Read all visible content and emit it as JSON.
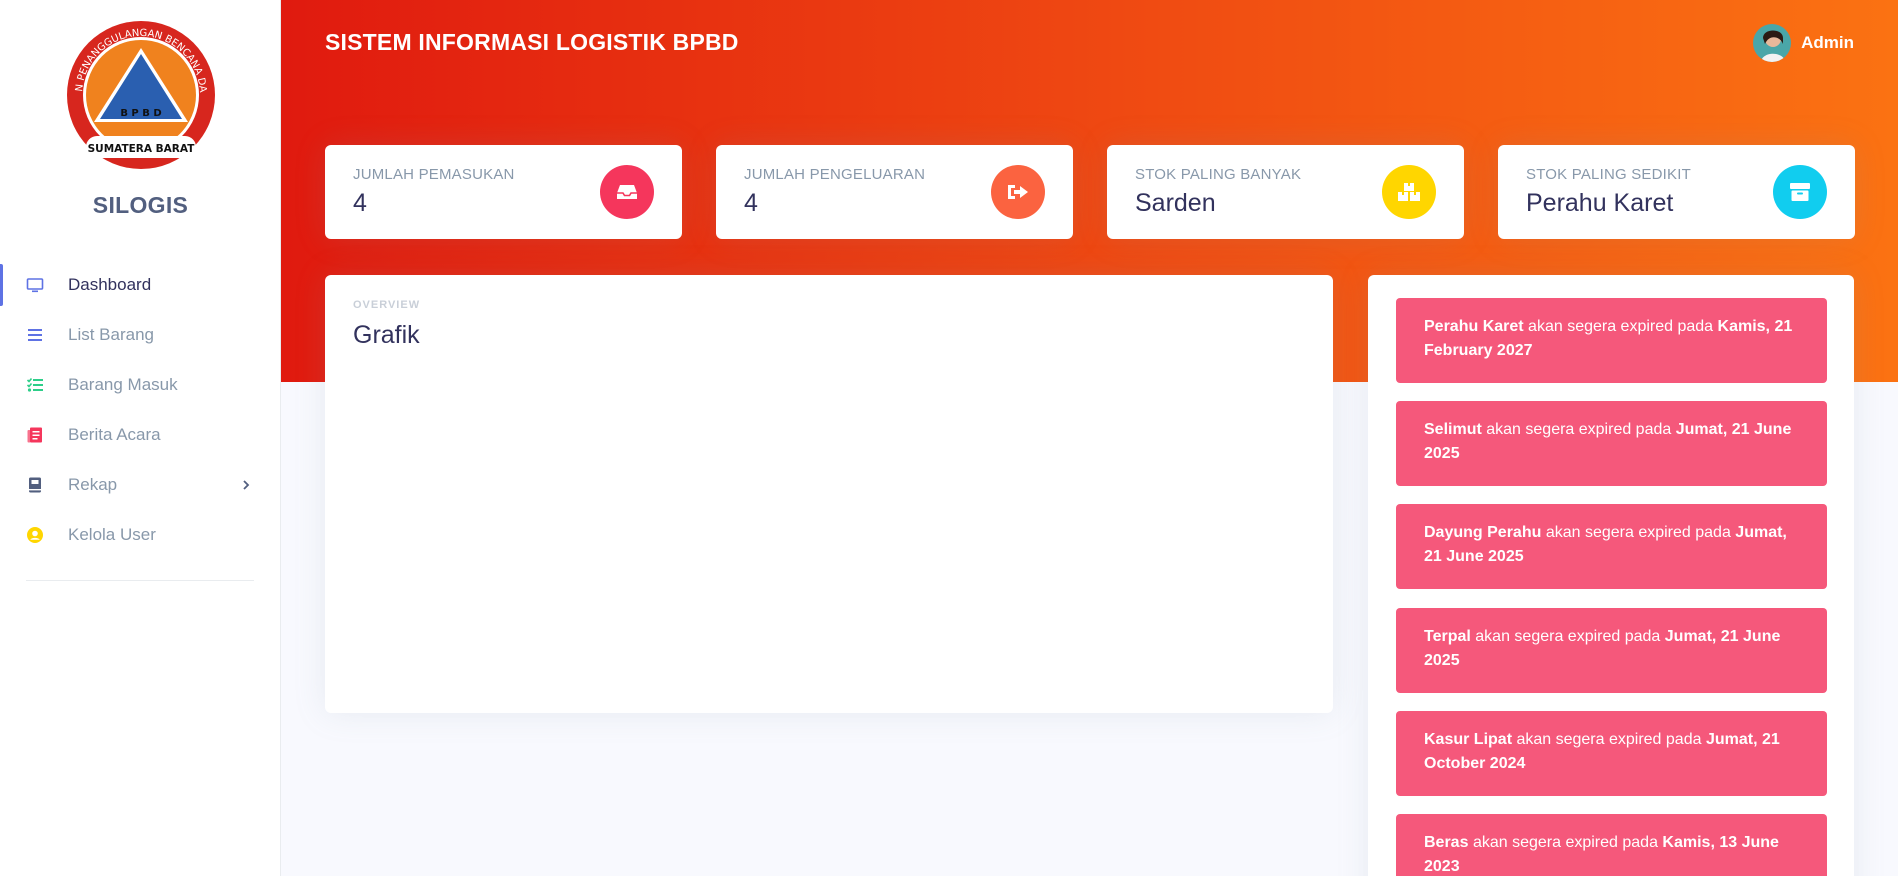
{
  "brand": "SILOGIS",
  "logo": {
    "top_text": "BADAN PENANGGULANGAN BENCANA DAERAH",
    "center_text": "B P B D",
    "bottom_text": "SUMATERA BARAT"
  },
  "sidebar": {
    "items": [
      {
        "label": "Dashboard",
        "icon": "monitor-icon",
        "color": "#5e72e4",
        "active": true
      },
      {
        "label": "List Barang",
        "icon": "list-icon",
        "color": "#5e72e4"
      },
      {
        "label": "Barang Masuk",
        "icon": "checklist-icon",
        "color": "#2dce89"
      },
      {
        "label": "Berita Acara",
        "icon": "document-icon",
        "color": "#f5365c"
      },
      {
        "label": "Rekap",
        "icon": "book-icon",
        "color": "#525f7f",
        "has_submenu": true
      },
      {
        "label": "Kelola User",
        "icon": "user-circle-icon",
        "color": "#ffd600"
      }
    ]
  },
  "header": {
    "title": "SISTEM INFORMASI LOGISTIK BPBD",
    "user_name": "Admin"
  },
  "stats": [
    {
      "label": "JUMLAH PEMASUKAN",
      "value": "4",
      "icon": "inbox-icon",
      "color": "#f5365c"
    },
    {
      "label": "JUMLAH PENGELUARAN",
      "value": "4",
      "icon": "sign-out-icon",
      "color": "#fb6340"
    },
    {
      "label": "STOK PALING BANYAK",
      "value": "Sarden",
      "icon": "boxes-icon",
      "color": "#ffd600"
    },
    {
      "label": "STOK PALING SEDIKIT",
      "value": "Perahu Karet",
      "icon": "box-icon",
      "color": "#11cdef"
    }
  ],
  "chart": {
    "overline": "OVERVIEW",
    "title": "Grafik"
  },
  "alerts": {
    "connector": "akan segera expired pada",
    "items": [
      {
        "item": "Perahu Karet",
        "date": "Kamis, 21 February 2027"
      },
      {
        "item": "Selimut",
        "date": "Jumat, 21 June 2025"
      },
      {
        "item": "Dayung Perahu",
        "date": "Jumat, 21 June 2025"
      },
      {
        "item": "Terpal",
        "date": "Jumat, 21 June 2025"
      },
      {
        "item": "Kasur Lipat",
        "date": "Jumat, 21 October 2024"
      },
      {
        "item": "Beras",
        "date": "Kamis, 13 June 2023"
      }
    ]
  },
  "colors": {
    "header_gradient_start": "#e01a0f",
    "header_gradient_end": "#fb7212",
    "alert_bg": "#f5587b",
    "accent": "#5e72e4"
  }
}
